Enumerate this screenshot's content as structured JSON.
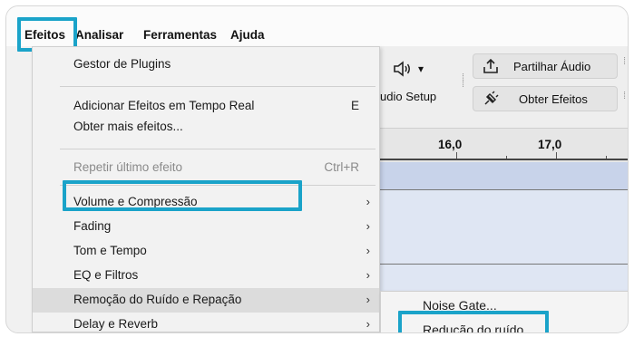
{
  "menubar": {
    "items": [
      "Efeitos",
      "Analisar",
      "Ferramentas",
      "Ajuda"
    ]
  },
  "toolbar": {
    "audio_setup_label": "udio Setup",
    "volume_arrow": "▾",
    "share_label": "Partilhar Áudio",
    "get_effects_label": "Obter Efeitos"
  },
  "ruler": {
    "labels": [
      "16,0",
      "17,0"
    ]
  },
  "dropdown": {
    "items": [
      {
        "label": "Gestor de Plugins",
        "shortcut": "",
        "submenu": false,
        "disabled": false
      },
      {
        "label": "Adicionar Efeitos em Tempo Real",
        "shortcut": "E",
        "submenu": false,
        "disabled": false
      },
      {
        "label": "Obter mais efeitos...",
        "shortcut": "",
        "submenu": false,
        "disabled": false
      },
      {
        "label": "Repetir último efeito",
        "shortcut": "Ctrl+R",
        "submenu": false,
        "disabled": true
      },
      {
        "label": "Volume e Compressão",
        "shortcut": "",
        "submenu": true,
        "disabled": false
      },
      {
        "label": "Fading",
        "shortcut": "",
        "submenu": true,
        "disabled": false
      },
      {
        "label": "Tom e Tempo",
        "shortcut": "",
        "submenu": true,
        "disabled": false
      },
      {
        "label": "EQ e Filtros",
        "shortcut": "",
        "submenu": true,
        "disabled": false
      },
      {
        "label": "Remoção do Ruído e Repação",
        "shortcut": "",
        "submenu": true,
        "disabled": false
      },
      {
        "label": "Delay e Reverb",
        "shortcut": "",
        "submenu": true,
        "disabled": false
      }
    ],
    "arrow_glyph": "›"
  },
  "submenu": {
    "items": [
      "Noise Gate...",
      "Redução do ruído..."
    ]
  },
  "colors": {
    "highlight_border": "#1aa3c9",
    "active_item": "#dcdcdc",
    "track_band": "#c8d3ea"
  }
}
